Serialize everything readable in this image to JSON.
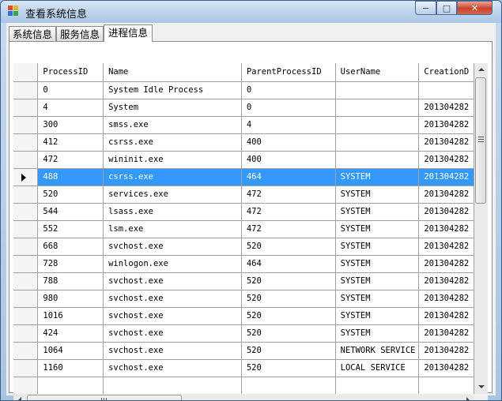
{
  "window": {
    "title": "查看系统信息",
    "controls": {
      "minimize": "−",
      "maximize": "□",
      "close": "✕"
    }
  },
  "tabs": [
    {
      "label": "系统信息",
      "active": false
    },
    {
      "label": "服务信息",
      "active": false
    },
    {
      "label": "进程信息",
      "active": true
    }
  ],
  "grid": {
    "columns": [
      "ProcessID",
      "Name",
      "ParentProcessID",
      "UserName",
      "CreationD"
    ],
    "selected_row": 5,
    "rows": [
      [
        "0",
        "System Idle Process",
        "0",
        "",
        ""
      ],
      [
        "4",
        "System",
        "0",
        "",
        "201304282"
      ],
      [
        "300",
        "smss.exe",
        "4",
        "",
        "201304282"
      ],
      [
        "412",
        "csrss.exe",
        "400",
        "",
        "201304282"
      ],
      [
        "472",
        "wininit.exe",
        "400",
        "",
        "201304282"
      ],
      [
        "488",
        "csrss.exe",
        "464",
        "SYSTEM",
        "201304282"
      ],
      [
        "520",
        "services.exe",
        "472",
        "SYSTEM",
        "201304282"
      ],
      [
        "544",
        "lsass.exe",
        "472",
        "SYSTEM",
        "201304282"
      ],
      [
        "552",
        "lsm.exe",
        "472",
        "SYSTEM",
        "201304282"
      ],
      [
        "668",
        "svchost.exe",
        "520",
        "SYSTEM",
        "201304282"
      ],
      [
        "728",
        "winlogon.exe",
        "464",
        "SYSTEM",
        "201304282"
      ],
      [
        "788",
        "svchost.exe",
        "520",
        "SYSTEM",
        "201304282"
      ],
      [
        "980",
        "svchost.exe",
        "520",
        "SYSTEM",
        "201304282"
      ],
      [
        "1016",
        "svchost.exe",
        "520",
        "SYSTEM",
        "201304282"
      ],
      [
        "424",
        "svchost.exe",
        "520",
        "SYSTEM",
        "201304282"
      ],
      [
        "1064",
        "svchost.exe",
        "520",
        "NETWORK SERVICE",
        "201304282"
      ],
      [
        "1160",
        "svchost.exe",
        "520",
        "LOCAL SERVICE",
        "201304282"
      ],
      [
        "",
        "",
        "",
        "",
        ""
      ]
    ]
  },
  "icons": {
    "app": "app-windows-icon",
    "selected_row": "row-selector-arrow-icon",
    "scroll": [
      "scroll-up-icon",
      "scroll-down-icon",
      "scroll-left-icon",
      "scroll-right-icon"
    ]
  },
  "colors": {
    "selection": "#3399ff",
    "titlebar": "#bcd3ec",
    "close_button": "#c7432c"
  }
}
